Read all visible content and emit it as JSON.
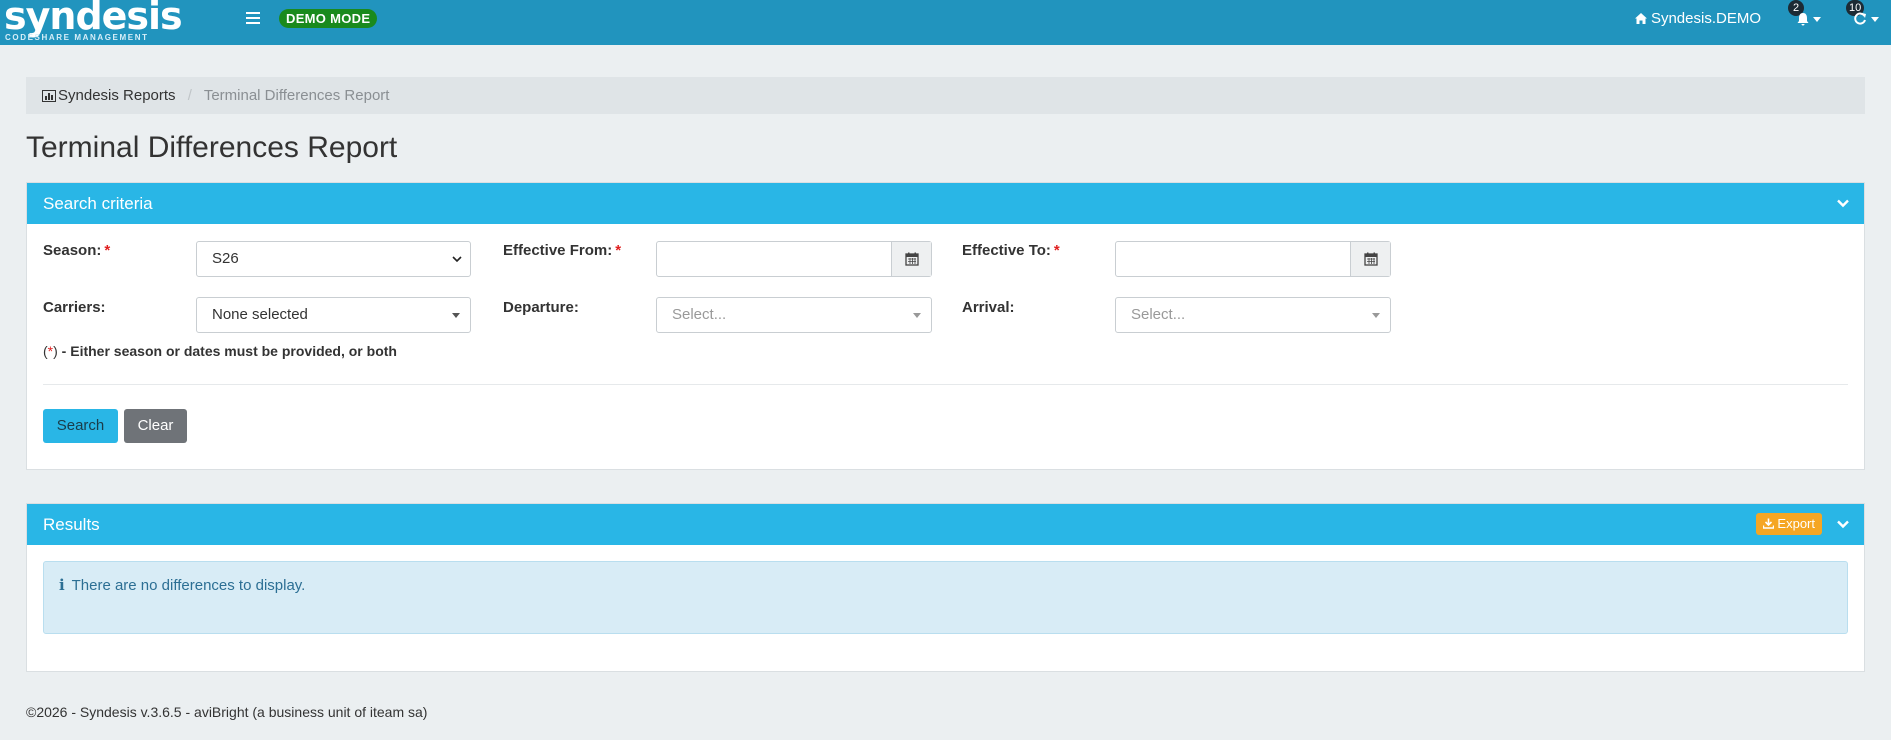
{
  "navbar": {
    "brand_name": "syndesis",
    "brand_sub": "CODESHARE MANAGEMENT",
    "mode_badge": "DEMO MODE",
    "home_label": "Syndesis.DEMO",
    "notifications_count": "2",
    "refresh_count": "10",
    "icons": {
      "menu": "hamburger-icon",
      "home": "home-icon",
      "bell": "bell-icon",
      "refresh": "refresh-icon"
    }
  },
  "breadcrumb": {
    "root_label": "Syndesis Reports",
    "current_label": "Terminal Differences Report",
    "separator": "/"
  },
  "page": {
    "title": "Terminal Differences Report"
  },
  "search_panel": {
    "heading": "Search criteria",
    "season_label": "Season:",
    "season_value": "S26",
    "effective_from_label": "Effective From:",
    "effective_from_value": "",
    "effective_to_label": "Effective To:",
    "effective_to_value": "",
    "carriers_label": "Carriers:",
    "carriers_value": "None selected",
    "departure_label": "Departure:",
    "departure_placeholder": "Select...",
    "arrival_label": "Arrival:",
    "arrival_placeholder": "Select...",
    "required_mark": "*",
    "note_open": "(",
    "note_close": ")",
    "note_text": " - Either season or dates must be provided, or both",
    "search_button": "Search",
    "clear_button": "Clear"
  },
  "results_panel": {
    "heading": "Results",
    "export_button": "Export",
    "info_icon": "i",
    "info_message": " There are no differences to display."
  },
  "footer": {
    "text": "©2026 - Syndesis v.3.6.5 - aviBright (a business unit of iteam sa)"
  },
  "colors": {
    "navbar": "#2194be",
    "panel_heading": "#29b6e6",
    "demo_badge": "#1a8a1d",
    "export": "#f5a623",
    "required": "#e01f1f"
  }
}
